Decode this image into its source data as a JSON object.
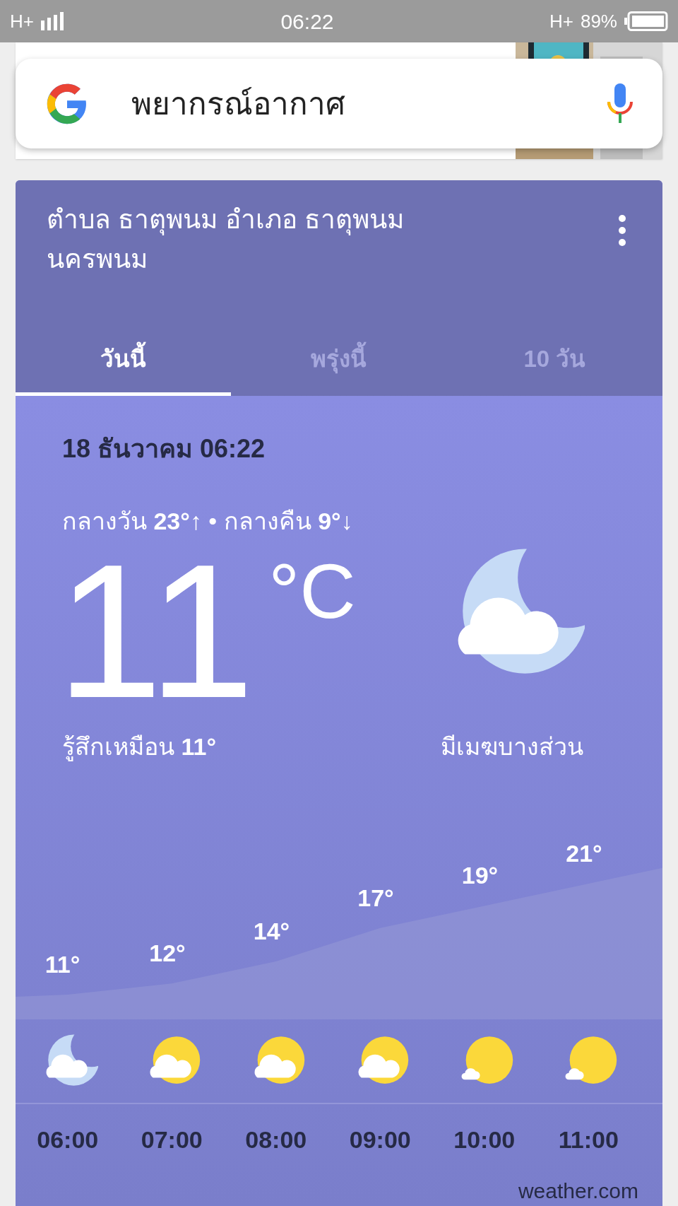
{
  "status_bar": {
    "network": "H+",
    "time": "06:22",
    "network_right": "H+",
    "battery": "89%"
  },
  "search": {
    "query": "พยากรณ์อากาศ"
  },
  "weather": {
    "location": "ตำบล ธาตุพนม อำเภอ ธาตุพนม นครพนม",
    "tabs": [
      {
        "label": "วันนี้",
        "selected": true
      },
      {
        "label": "พรุ่งนี้",
        "selected": false
      },
      {
        "label": "10 วัน",
        "selected": false
      }
    ],
    "date": "18 ธันวาคม 06:22",
    "high_low": "กลางวัน **23°**↑ • กลางคืน **9°**↓",
    "temperature": "11",
    "unit": "°C",
    "feels_like": "รู้สึกเหมือน **11°**",
    "condition": "มีเมฆบางส่วน",
    "condition_icon": {
      "kind": "moon_cloud"
    },
    "hourly": [
      {
        "temp": "11°",
        "kind": "moon_cloud",
        "time": "06:00"
      },
      {
        "temp": "12°",
        "kind": "sun_cloud",
        "time": "07:00"
      },
      {
        "temp": "14°",
        "kind": "sun_cloud",
        "time": "08:00"
      },
      {
        "temp": "17°",
        "kind": "sun_cloud",
        "time": "09:00"
      },
      {
        "temp": "19°",
        "kind": "sun_small_cloud",
        "time": "10:00"
      },
      {
        "temp": "21°",
        "kind": "sun_small_cloud",
        "time": "11:00"
      }
    ],
    "source": "weather.com"
  }
}
